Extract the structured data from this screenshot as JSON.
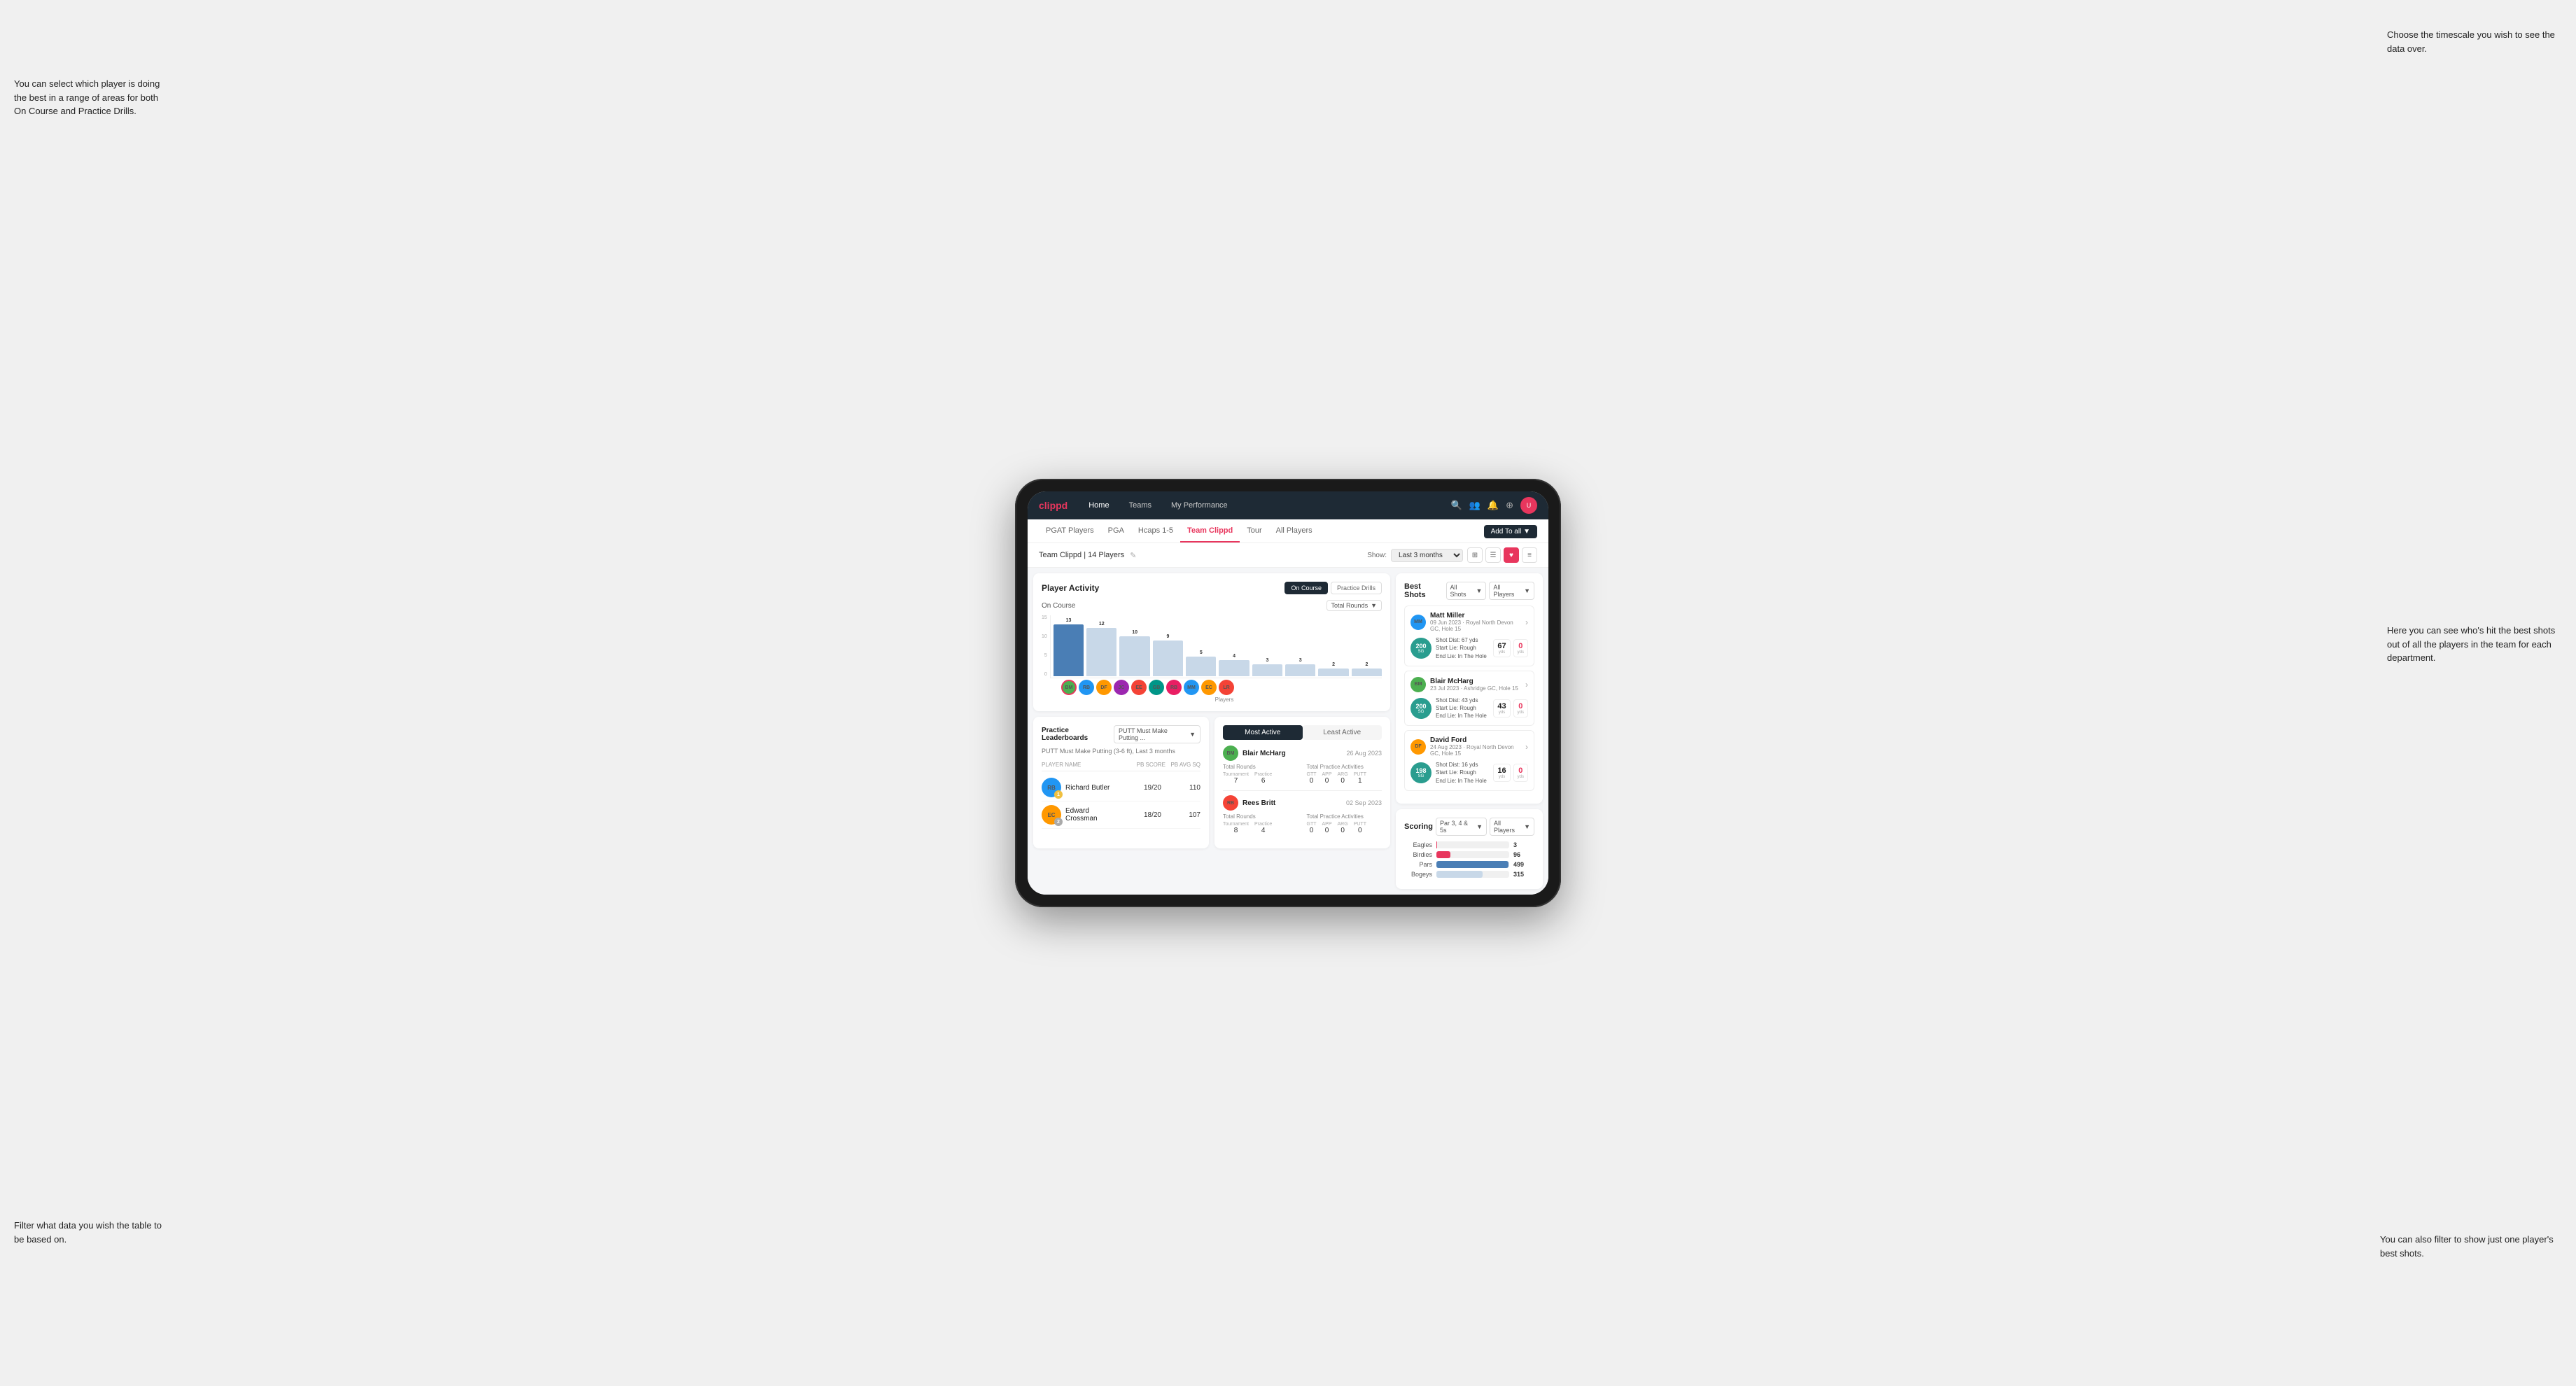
{
  "annotations": {
    "top_left": "You can select which player is doing the best in a range of areas for both On Course and Practice Drills.",
    "bottom_left": "Filter what data you wish the table to be based on.",
    "top_right": "Choose the timescale you wish to see the data over.",
    "mid_right": "Here you can see who's hit the best shots out of all the players in the team for each department.",
    "bottom_right": "You can also filter to show just one player's best shots."
  },
  "nav": {
    "logo": "clippd",
    "items": [
      "Home",
      "Teams",
      "My Performance"
    ],
    "icons": [
      "search",
      "users",
      "bell",
      "plus",
      "avatar"
    ]
  },
  "sub_nav": {
    "items": [
      "PGAT Players",
      "PGA",
      "Hcaps 1-5",
      "Team Clippd",
      "Tour",
      "All Players"
    ],
    "active": "Team Clippd",
    "add_button": "Add To all ▼"
  },
  "team_header": {
    "title": "Team Clippd | 14 Players",
    "show_label": "Show:",
    "time_filter": "Last 3 months",
    "view_options": [
      "grid",
      "list",
      "heart",
      "settings"
    ]
  },
  "player_activity": {
    "title": "Player Activity",
    "toggle_on_course": "On Course",
    "toggle_practice": "Practice Drills",
    "active_toggle": "On Course",
    "sub_title": "On Course",
    "chart_filter": "Total Rounds",
    "bars": [
      {
        "label": "13",
        "name": "B. McHarg",
        "value": 13,
        "highlighted": true
      },
      {
        "label": "12",
        "name": "R. Britt",
        "value": 12,
        "highlighted": false
      },
      {
        "label": "10",
        "name": "D. Ford",
        "value": 10,
        "highlighted": false
      },
      {
        "label": "9",
        "name": "J. Coles",
        "value": 9,
        "highlighted": false
      },
      {
        "label": "5",
        "name": "E. Ebert",
        "value": 5,
        "highlighted": false
      },
      {
        "label": "4",
        "name": "G. Billingham",
        "value": 4,
        "highlighted": false
      },
      {
        "label": "3",
        "name": "R. Butler",
        "value": 3,
        "highlighted": false
      },
      {
        "label": "3",
        "name": "M. Miller",
        "value": 3,
        "highlighted": false
      },
      {
        "label": "2",
        "name": "E. Crossman",
        "value": 2,
        "highlighted": false
      },
      {
        "label": "2",
        "name": "L. Robertson",
        "value": 2,
        "highlighted": false
      }
    ],
    "y_axis": [
      "15",
      "10",
      "5",
      "0"
    ],
    "x_label": "Players"
  },
  "best_shots": {
    "title": "Best Shots",
    "filter_all_shots": "All Shots",
    "filter_all_players": "All Players",
    "players": [
      {
        "name": "Matt Miller",
        "sub": "09 Jun 2023 · Royal North Devon GC, Hole 15",
        "badge_num": "200",
        "badge_label": "SG",
        "desc": "Shot Dist: 67 yds\nStart Lie: Rough\nEnd Lie: In The Hole",
        "yds1": "67",
        "yds2": "0",
        "badge_color": "#2a9d8f"
      },
      {
        "name": "Blair McHarg",
        "sub": "23 Jul 2023 · Ashridge GC, Hole 15",
        "badge_num": "200",
        "badge_label": "SG",
        "desc": "Shot Dist: 43 yds\nStart Lie: Rough\nEnd Lie: In The Hole",
        "yds1": "43",
        "yds2": "0",
        "badge_color": "#2a9d8f"
      },
      {
        "name": "David Ford",
        "sub": "24 Aug 2023 · Royal North Devon GC, Hole 15",
        "badge_num": "198",
        "badge_label": "SG",
        "desc": "Shot Dist: 16 yds\nStart Lie: Rough\nEnd Lie: In The Hole",
        "yds1": "16",
        "yds2": "0",
        "badge_color": "#2a9d8f"
      }
    ]
  },
  "practice_leaderboards": {
    "title": "Practice Leaderboards",
    "drill_filter": "PUTT Must Make Putting ...",
    "subtitle": "PUTT Must Make Putting (3-6 ft), Last 3 months",
    "columns": [
      "PLAYER NAME",
      "PB SCORE",
      "PB AVG SQ"
    ],
    "players": [
      {
        "name": "Richard Butler",
        "score": "19/20",
        "avg": "110",
        "rank": 1
      },
      {
        "name": "Edward Crossman",
        "score": "18/20",
        "avg": "107",
        "rank": 2
      }
    ]
  },
  "most_active": {
    "tab_active": "Most Active",
    "tab_inactive": "Least Active",
    "players": [
      {
        "name": "Blair McHarg",
        "date": "26 Aug 2023",
        "total_rounds_label": "Total Rounds",
        "tournament": "7",
        "practice": "6",
        "total_practice_label": "Total Practice Activities",
        "gtt": "0",
        "app": "0",
        "arg": "0",
        "putt": "1"
      },
      {
        "name": "Rees Britt",
        "date": "02 Sep 2023",
        "total_rounds_label": "Total Rounds",
        "tournament": "8",
        "practice": "4",
        "total_practice_label": "Total Practice Activities",
        "gtt": "0",
        "app": "0",
        "arg": "0",
        "putt": "0"
      }
    ]
  },
  "scoring": {
    "title": "Scoring",
    "filter": "Par 3, 4 & 5s",
    "players_filter": "All Players",
    "bars": [
      {
        "label": "Eagles",
        "value": 3,
        "max": 500,
        "color": "#e8365d"
      },
      {
        "label": "Birdies",
        "value": 96,
        "max": 500,
        "color": "#e8365d"
      },
      {
        "label": "Pars",
        "value": 499,
        "max": 500,
        "color": "#4a7eb5"
      },
      {
        "label": "Bogeys",
        "value": 315,
        "max": 500,
        "color": "#c8d8e8"
      }
    ]
  }
}
